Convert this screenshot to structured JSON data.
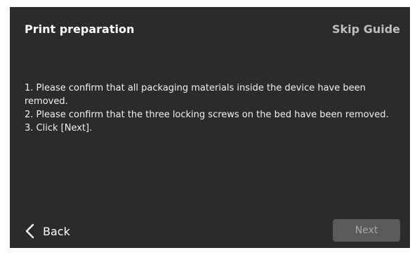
{
  "header": {
    "title": "Print preparation",
    "skip_label": "Skip Guide"
  },
  "instructions": {
    "step1": "1. Please confirm that all packaging materials inside the device have been removed.",
    "step2": "2. Please confirm that the three locking screws on the bed have been removed.",
    "step3": "3. Click [Next]."
  },
  "footer": {
    "back_label": "Back",
    "back_icon": "chevron-left-icon",
    "next_label": "Next",
    "next_state": "disabled"
  },
  "colors": {
    "screen_bg": "#2b2b2b",
    "text": "#ffffff",
    "muted_text": "#bdbdbd",
    "button_disabled_bg": "#5a5a5a",
    "button_disabled_text": "#a7a7a7"
  }
}
